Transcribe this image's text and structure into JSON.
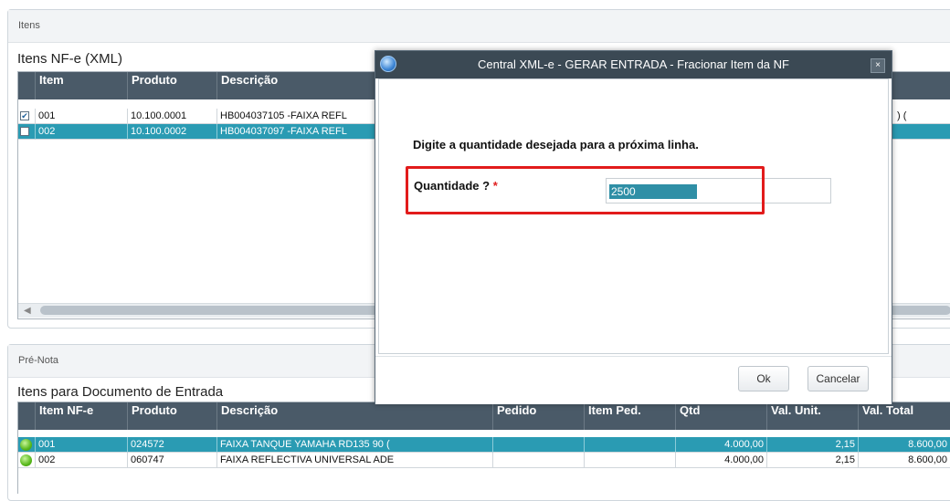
{
  "itens_panel": {
    "title": "Itens",
    "grid_title": "Itens NF-e (XML)",
    "columns": [
      "Item",
      "Produto",
      "Descrição"
    ],
    "rows": [
      {
        "item": "001",
        "produto": "10.100.0001",
        "descricao": "HB004037105 -FAIXA REFL",
        "tail": ") (",
        "checked": true
      },
      {
        "item": "002",
        "produto": "10.100.0002",
        "descricao": "HB004037097 -FAIXA REFL",
        "tail": "",
        "checked": false
      }
    ]
  },
  "prenota_panel": {
    "title": "Pré-Nota",
    "grid_title": "Itens para Documento de Entrada",
    "columns": [
      "Item NF-e",
      "Produto",
      "Descrição",
      "Pedido",
      "Item Ped.",
      "Qtd",
      "Val. Unit.",
      "Val. Total"
    ],
    "rows": [
      {
        "item": "001",
        "produto": "024572",
        "descricao": "FAIXA TANQUE YAMAHA RD135 90 (",
        "pedido": "",
        "item_ped": "",
        "qtd": "4.000,00",
        "val_unit": "2,15",
        "val_total": "8.600,00"
      },
      {
        "item": "002",
        "produto": "060747",
        "descricao": "FAIXA REFLECTIVA UNIVERSAL ADE",
        "pedido": "",
        "item_ped": "",
        "qtd": "4.000,00",
        "val_unit": "2,15",
        "val_total": "8.600,00"
      }
    ]
  },
  "dialog": {
    "title": "Central XML-e - GERAR ENTRADA - Fracionar Item da NF",
    "close_glyph": "×",
    "prompt": "Digite a quantidade desejada para a próxima linha.",
    "field_label": "Quantidade ?",
    "required_mark": "*",
    "field_value": "2500",
    "ok_label": "Ok",
    "cancel_label": "Cancelar"
  },
  "colors": {
    "header_bg": "#4a5a68",
    "selected_row": "#2a9bb3",
    "highlight_box": "#e21b1b",
    "dialog_titlebar": "#3b4954"
  }
}
